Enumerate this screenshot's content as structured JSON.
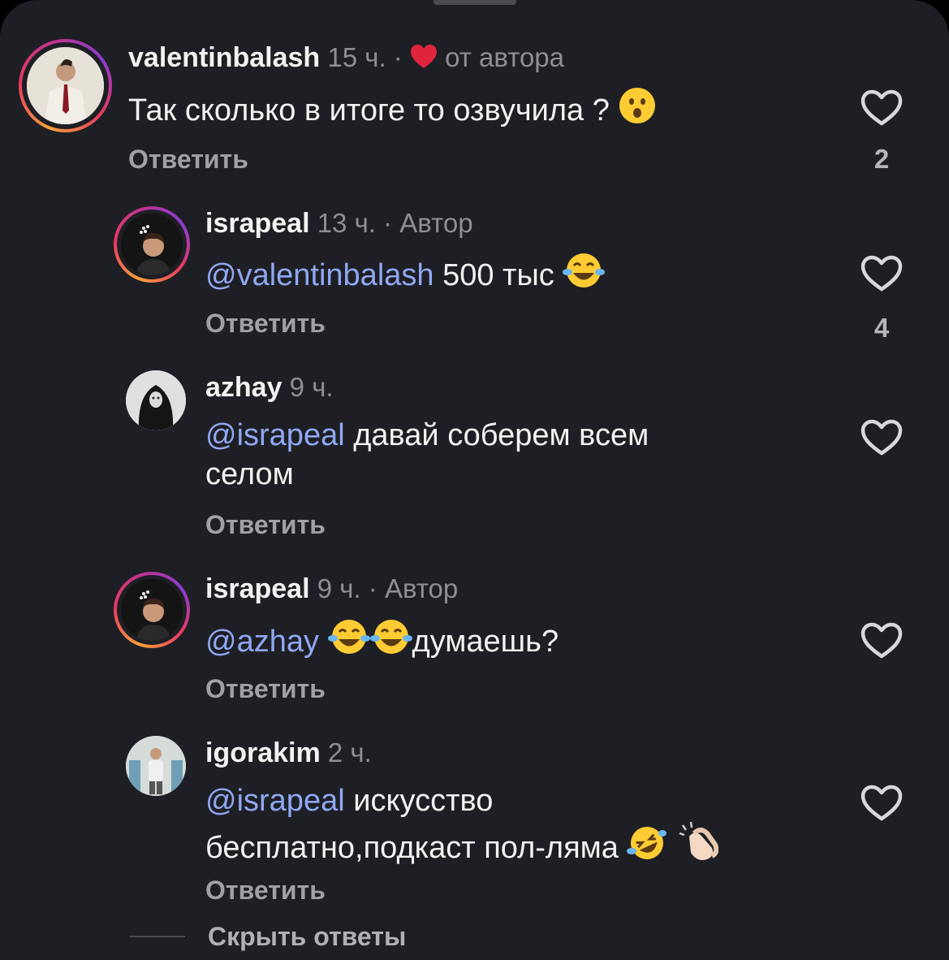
{
  "comments": [
    {
      "username": "valentinbalash",
      "time": "15 ч.",
      "sep": "·",
      "tag": "от автора",
      "text": "Так сколько в итоге то озвучила ?",
      "emoji": [
        "hushed-face"
      ],
      "reply": "Ответить",
      "likes": "2"
    },
    {
      "username": "israpeal",
      "time": "13 ч.",
      "sep": "·",
      "tag": "Автор",
      "mention": "@valentinbalash",
      "text": " 500 тыс",
      "emoji": [
        "face-with-tears-of-joy"
      ],
      "reply": "Ответить",
      "likes": "4"
    },
    {
      "username": "azhay",
      "time": "9 ч.",
      "mention": "@israpeal",
      "text_line1": " давай соберем всем",
      "text_line2": "селом",
      "reply": "Ответить"
    },
    {
      "username": "israpeal",
      "time": "9 ч.",
      "sep": "·",
      "tag": "Автор",
      "mention": "@azhay",
      "text": "думаешь?",
      "emoji": [
        "face-with-tears-of-joy",
        "face-with-tears-of-joy"
      ],
      "reply": "Ответить"
    },
    {
      "username": "igorakim",
      "time": "2 ч.",
      "mention": "@israpeal",
      "text_line1": " искусство",
      "text_line2": "бесплатно,подкаст пол-ляма",
      "emoji": [
        "rolling-on-the-floor-laughing",
        "clapping-hands"
      ],
      "reply": "Ответить"
    }
  ],
  "hide_replies": "Скрыть ответы",
  "colors": {
    "background": "#1e1f24",
    "mention": "#8fa7f2",
    "heart_red": "#e0243c",
    "story_ring": "#e83a5f"
  }
}
